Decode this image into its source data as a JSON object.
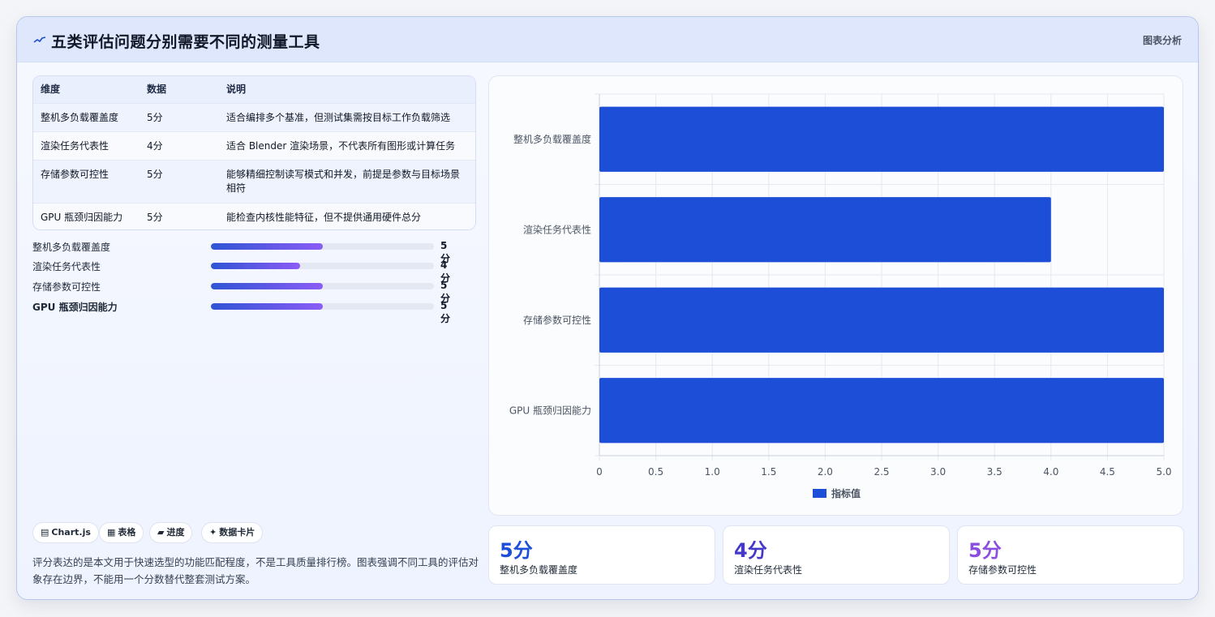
{
  "header": {
    "title": "五类评估问题分别需要不同的测量工具",
    "tag": "图表分析",
    "icon": "trend-line-icon"
  },
  "table": {
    "headers": [
      "维度",
      "数据",
      "说明"
    ],
    "rows": [
      {
        "dim": "整机多负载覆盖度",
        "val": "5分",
        "desc": "适合编排多个基准，但测试集需按目标工作负载筛选"
      },
      {
        "dim": "渲染任务代表性",
        "val": "4分",
        "desc": "适合 Blender 渲染场景，不代表所有图形或计算任务"
      },
      {
        "dim": "存储参数可控性",
        "val": "5分",
        "desc": "能够精细控制读写模式和并发，前提是参数与目标场景相符"
      },
      {
        "dim": "GPU 瓶颈归因能力",
        "val": "5分",
        "desc": "能检查内核性能特征，但不提供通用硬件总分"
      }
    ]
  },
  "progress": [
    {
      "label": "整机多负载覆盖度",
      "value": 5,
      "max": 10,
      "text": "5分"
    },
    {
      "label": "渲染任务代表性",
      "value": 4,
      "max": 10,
      "text": "4分"
    },
    {
      "label": "存储参数可控性",
      "value": 5,
      "max": 10,
      "text": "5分"
    },
    {
      "label": "GPU 瓶颈归因能力",
      "value": 5,
      "max": 10,
      "text": "5分"
    }
  ],
  "chips": [
    {
      "icon": "▤",
      "label": "Chart.js"
    },
    {
      "icon": "▦",
      "label": "表格"
    },
    {
      "icon": "▰",
      "label": "进度"
    },
    {
      "icon": "✦",
      "label": "数据卡片"
    }
  ],
  "note": "评分表达的是本文用于快速选型的功能匹配程度，不是工具质量排行榜。图表强调不同工具的评估对象存在边界，不能用一个分数替代整套测试方案。",
  "stats": [
    {
      "value": "5分",
      "label": "整机多负载覆盖度",
      "color": "#1d4ed8"
    },
    {
      "value": "4分",
      "label": "渲染任务代表性",
      "color": "#4338ca"
    },
    {
      "value": "5分",
      "label": "存储参数可控性",
      "color": "#8b4fe0"
    }
  ],
  "chart_data": {
    "type": "bar",
    "orientation": "horizontal",
    "categories": [
      "整机多负载覆盖度",
      "渲染任务代表性",
      "存储参数可控性",
      "GPU 瓶颈归因能力"
    ],
    "series": [
      {
        "name": "指标值",
        "values": [
          5,
          4,
          5,
          5
        ]
      }
    ],
    "xlim": [
      0,
      5
    ],
    "xticks": [
      "0",
      "0.5",
      "1.0",
      "1.5",
      "2.0",
      "2.5",
      "3.0",
      "3.5",
      "4.0",
      "4.5",
      "5.0"
    ],
    "grid": true,
    "legend": "bottom",
    "bar_color": "#1d4ed8"
  }
}
